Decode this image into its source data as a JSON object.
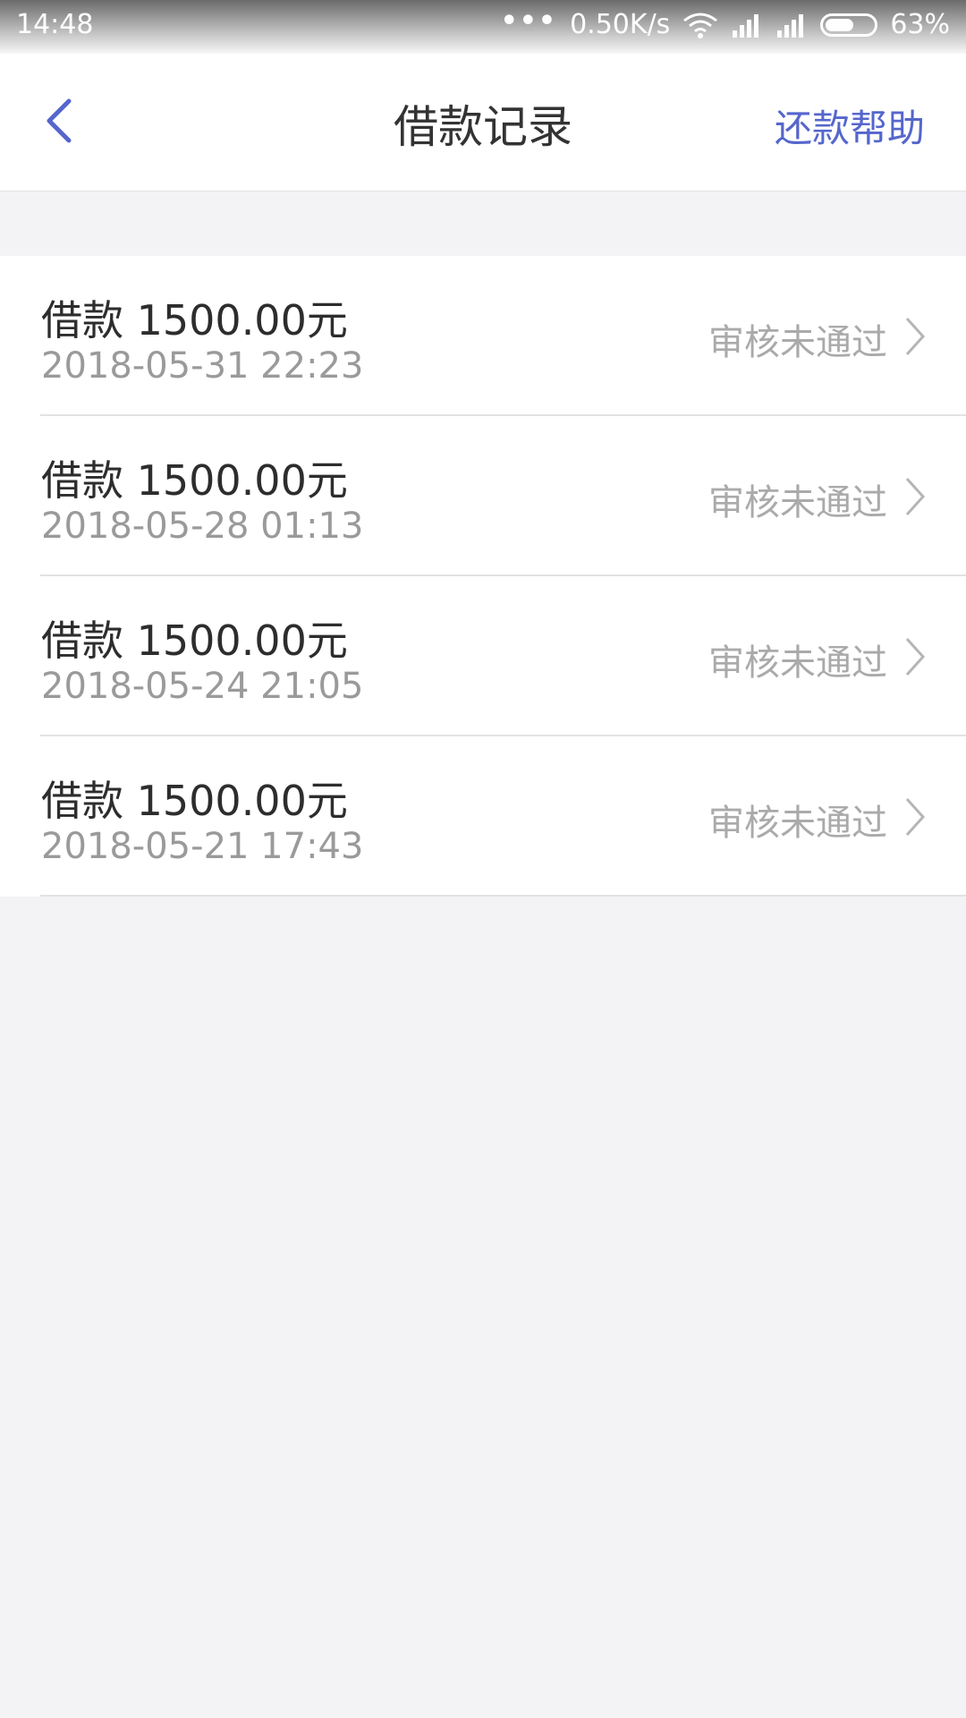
{
  "status_bar": {
    "time": "14:48",
    "network_speed": "0.50K/s",
    "battery_percent": "63%",
    "battery_level": 0.63
  },
  "header": {
    "title": "借款记录",
    "help_label": "还款帮助",
    "back_icon": "chevron-left-icon"
  },
  "records": [
    {
      "amount": "借款 1500.00元",
      "date": "2018-05-31 22:23",
      "status": "审核未通过"
    },
    {
      "amount": "借款 1500.00元",
      "date": "2018-05-28 01:13",
      "status": "审核未通过"
    },
    {
      "amount": "借款 1500.00元",
      "date": "2018-05-24 21:05",
      "status": "审核未通过"
    },
    {
      "amount": "借款 1500.00元",
      "date": "2018-05-21 17:43",
      "status": "审核未通过"
    }
  ],
  "colors": {
    "accent": "#5566cc",
    "background": "#f3f3f5",
    "status_text": "#aaaaaa"
  }
}
